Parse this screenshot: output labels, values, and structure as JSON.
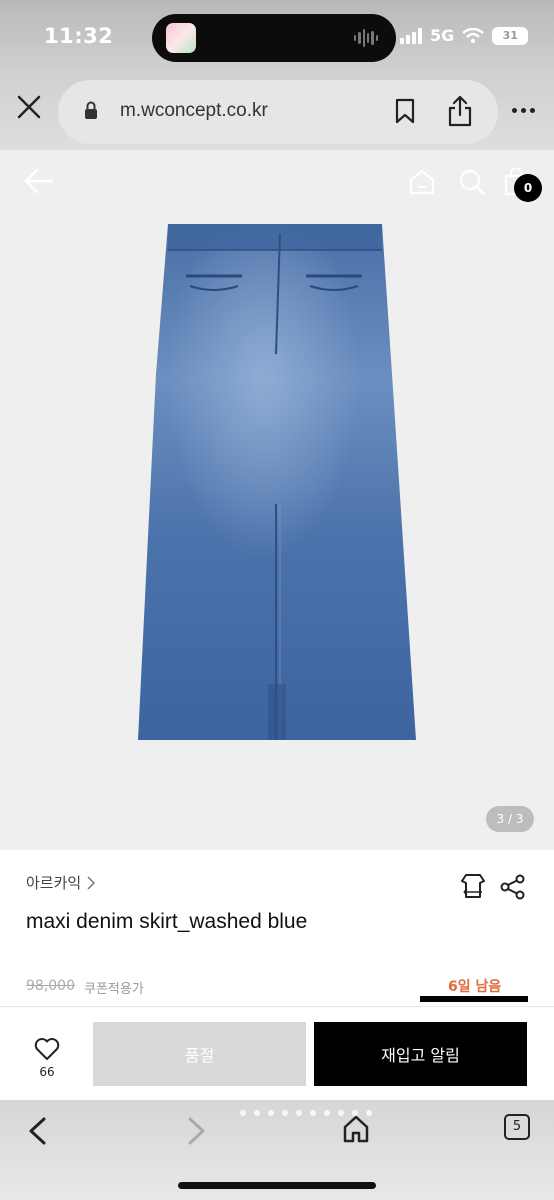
{
  "status_bar": {
    "time": "11:32",
    "network": "5G",
    "battery": "31"
  },
  "browser": {
    "url": "m.wconcept.co.kr"
  },
  "header": {
    "cart_count": "0"
  },
  "gallery": {
    "pager": "3 / 3"
  },
  "product": {
    "brand": "아르카익",
    "title": "maxi denim skirt_washed blue",
    "original_price": "98,000",
    "coupon_note": "쿠폰적용가",
    "days_left": "6일 남음"
  },
  "actions": {
    "like_count": "66",
    "soldout_label": "품절",
    "restock_label": "재입고 알림"
  },
  "bottom_nav": {
    "tab_count": "5"
  },
  "colors": {
    "accent": "#e06a3c",
    "primary_button": "#000000",
    "disabled_button": "#d9d9d9"
  }
}
